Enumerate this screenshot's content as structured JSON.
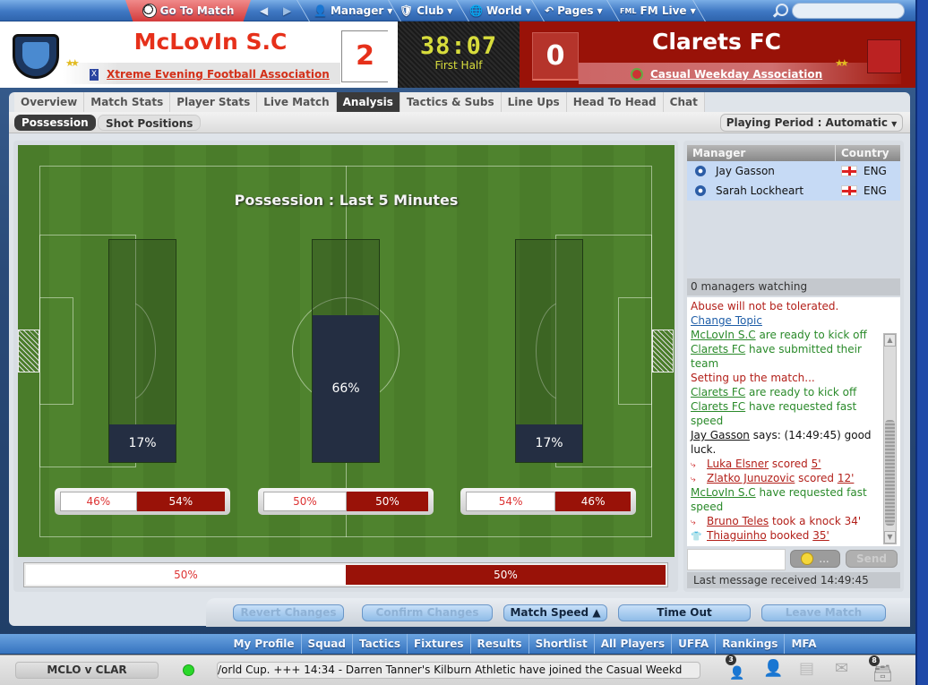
{
  "topnav": {
    "go_to_match": "Go To Match",
    "back_label": "◀",
    "forward_label": "▶",
    "items": [
      {
        "label": "Manager",
        "icon": "manager-icon"
      },
      {
        "label": "Club",
        "icon": "club-shield-icon"
      },
      {
        "label": "World",
        "icon": "globe-icon"
      },
      {
        "label": "Pages",
        "icon": "pages-icon"
      },
      {
        "label": "FM Live",
        "icon": "fml-icon"
      }
    ],
    "search_placeholder": ""
  },
  "match": {
    "home_team": "McLovIn S.C",
    "home_competition": "Xtreme Evening Football Association",
    "home_score": "2",
    "home_stars": "★★",
    "clock": "38:07",
    "period": "First Half",
    "away_team": "Clarets FC",
    "away_competition": "Casual Weekday Association",
    "away_score": "0",
    "away_stars": "★★",
    "colors": {
      "home": "#e6301a",
      "away": "#991208"
    }
  },
  "tabs": [
    {
      "label": "Overview",
      "active": false
    },
    {
      "label": "Match Stats",
      "active": false
    },
    {
      "label": "Player Stats",
      "active": false
    },
    {
      "label": "Live Match",
      "active": false
    },
    {
      "label": "Analysis",
      "active": true
    },
    {
      "label": "Tactics & Subs",
      "active": false
    },
    {
      "label": "Line Ups",
      "active": false
    },
    {
      "label": "Head To Head",
      "active": false
    },
    {
      "label": "Chat",
      "active": false
    }
  ],
  "subtabs": [
    {
      "label": "Possession",
      "active": true
    },
    {
      "label": "Shot Positions",
      "active": false
    }
  ],
  "playing_period": "Playing Period : Automatic",
  "possession": {
    "title": "Possession : Last 5 Minutes",
    "zones": [
      {
        "name": "left-third",
        "share": 17,
        "label": "17%",
        "home_label": "46%",
        "away_label": "54%",
        "home": 46,
        "away": 54
      },
      {
        "name": "middle-third",
        "share": 66,
        "label": "66%",
        "home_label": "50%",
        "away_label": "50%",
        "home": 50,
        "away": 50
      },
      {
        "name": "right-third",
        "share": 17,
        "label": "17%",
        "home_label": "54%",
        "away_label": "46%",
        "home": 54,
        "away": 46
      }
    ],
    "overall": {
      "home": 50,
      "away": 50,
      "home_label": "50%",
      "away_label": "50%"
    }
  },
  "chat": {
    "columns": {
      "manager": "Manager",
      "country": "Country"
    },
    "managers": [
      {
        "name": "Jay Gasson",
        "country": "ENG"
      },
      {
        "name": "Sarah Lockheart",
        "country": "ENG"
      }
    ],
    "watching": "0 managers watching",
    "notice": "Abuse will not be tolerated.",
    "change_topic": "Change Topic",
    "messages": [
      {
        "type": "green",
        "link": "McLovIn S.C",
        "text": " are ready to kick off"
      },
      {
        "type": "green",
        "link": "Clarets FC",
        "text": " have submitted their team"
      },
      {
        "type": "red",
        "link": "",
        "text": "Setting up the match..."
      },
      {
        "type": "green",
        "link": "Clarets FC",
        "text": " are ready to kick off"
      },
      {
        "type": "green",
        "link": "Clarets FC",
        "text": " have requested fast speed"
      },
      {
        "type": "dark",
        "link": "Jay Gasson",
        "text": " says: (14:49:45) good luck."
      },
      {
        "type": "event",
        "icon": "boot-icon",
        "link": "Luka Elsner",
        "text": " scored ",
        "minute": "5'"
      },
      {
        "type": "event",
        "icon": "boot-icon",
        "link": "Zlatko Junuzovic",
        "text": " scored ",
        "minute": "12'"
      },
      {
        "type": "green",
        "link": "McLovIn S.C",
        "text": " have requested fast speed"
      },
      {
        "type": "event",
        "icon": "boot-icon",
        "link": "Bruno Teles",
        "text": " took a knock 34'",
        "minute": ""
      },
      {
        "type": "event",
        "icon": "shirt-icon",
        "link": "Thiaguinho",
        "text": " booked ",
        "minute": "35'"
      }
    ],
    "input_value": "",
    "emoji_label": "...",
    "send_label": "Send",
    "last_message": "Last message received 14:49:45"
  },
  "actions": {
    "revert": "Revert Changes",
    "confirm": "Confirm Changes",
    "match_speed": "Match Speed ▲",
    "time_out": "Time Out",
    "leave": "Leave Match"
  },
  "bottomnav": [
    "My Profile",
    "Squad",
    "Tactics",
    "Fixtures",
    "Results",
    "Shortlist",
    "All Players",
    "UFFA",
    "Rankings",
    "MFA"
  ],
  "status": {
    "match_code": "MCLO v CLAR",
    "ticker": "/orld Cup.   +++   14:34 - Darren Tanner's Kilburn Athletic have joined the Casual Weekd",
    "managers_badge": "3",
    "inbox_badge": "8"
  }
}
